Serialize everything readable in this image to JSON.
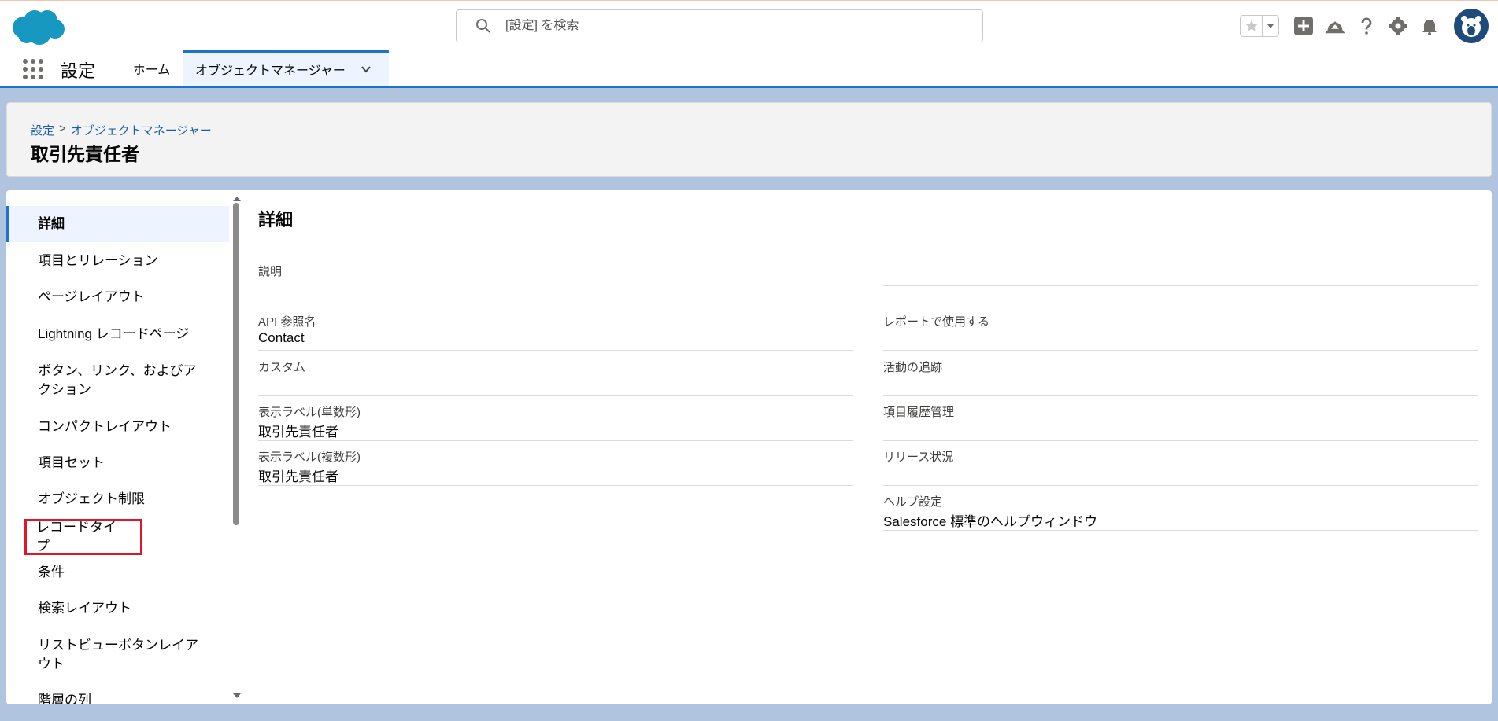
{
  "header": {
    "search_placeholder": "[設定] を検索"
  },
  "nav": {
    "app_name": "設定",
    "tabs": [
      {
        "label": "ホーム"
      },
      {
        "label": "オブジェクトマネージャー"
      }
    ]
  },
  "page": {
    "breadcrumb": [
      "設定",
      "オブジェクトマネージャー"
    ],
    "breadcrumb_sep": ">",
    "title": "取引先責任者"
  },
  "sidebar": {
    "items": [
      {
        "label": "詳細"
      },
      {
        "label": "項目とリレーション"
      },
      {
        "label": "ページレイアウト"
      },
      {
        "label": "Lightning レコードページ"
      },
      {
        "label": "ボタン、リンク、およびアクション"
      },
      {
        "label": "コンパクトレイアウト"
      },
      {
        "label": "項目セット"
      },
      {
        "label": "オブジェクト制限"
      },
      {
        "label": "レコードタイプ"
      },
      {
        "label": "条件"
      },
      {
        "label": "検索レイアウト"
      },
      {
        "label": "リストビューボタンレイアウト"
      },
      {
        "label": "階層の列"
      }
    ]
  },
  "detail": {
    "title": "詳細",
    "left_fields": [
      {
        "label": "説明",
        "value": ""
      },
      {
        "label": "API 参照名",
        "value": "Contact"
      },
      {
        "label": "カスタム",
        "value": ""
      },
      {
        "label": "表示ラベル(単数形)",
        "value": "取引先責任者"
      },
      {
        "label": "表示ラベル(複数形)",
        "value": "取引先責任者"
      }
    ],
    "right_fields": [
      {
        "label": "レポートで使用する",
        "value": ""
      },
      {
        "label": "活動の追跡",
        "value": ""
      },
      {
        "label": "項目履歴管理",
        "value": ""
      },
      {
        "label": "リリース状況",
        "value": ""
      },
      {
        "label": "ヘルプ設定",
        "value": "Salesforce 標準のヘルプウィンドウ"
      }
    ]
  },
  "colors": {
    "brand_blue": "#1d73c9",
    "link_blue": "#1b5fa6",
    "highlight_red": "#e0142a",
    "background": "#b0c4df"
  }
}
